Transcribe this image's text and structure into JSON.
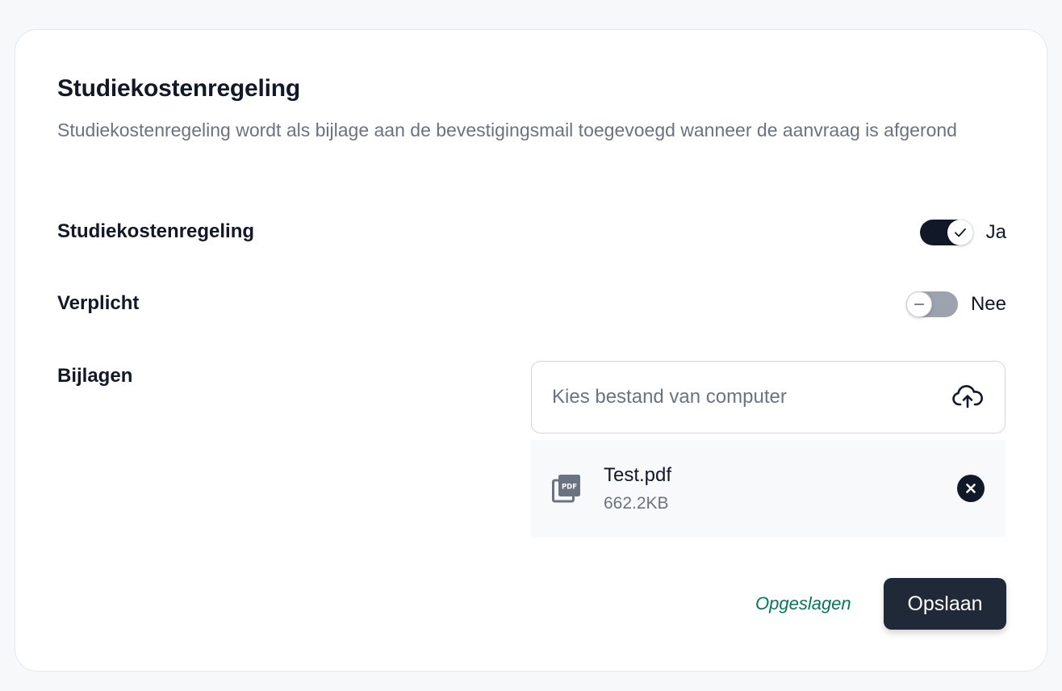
{
  "section": {
    "title": "Studiekostenregeling",
    "description": "Studiekostenregeling wordt als bijlage aan de bevestigingsmail toegevoegd wanneer de aanvraag is afgerond"
  },
  "settings": {
    "enabled": {
      "label": "Studiekostenregeling",
      "value": true,
      "value_text": "Ja"
    },
    "required": {
      "label": "Verplicht",
      "value": false,
      "value_text": "Nee"
    }
  },
  "attachments": {
    "label": "Bijlagen",
    "upload_placeholder": "Kies bestand van computer",
    "upload_icon": "cloud-upload-icon",
    "files": [
      {
        "name": "Test.pdf",
        "size": "662.2KB",
        "icon": "pdf-file-icon"
      }
    ]
  },
  "footer": {
    "status_text": "Opgeslagen",
    "save_label": "Opslaan"
  },
  "colors": {
    "primary": "#111827",
    "success": "#047857",
    "muted": "#6b7280"
  }
}
